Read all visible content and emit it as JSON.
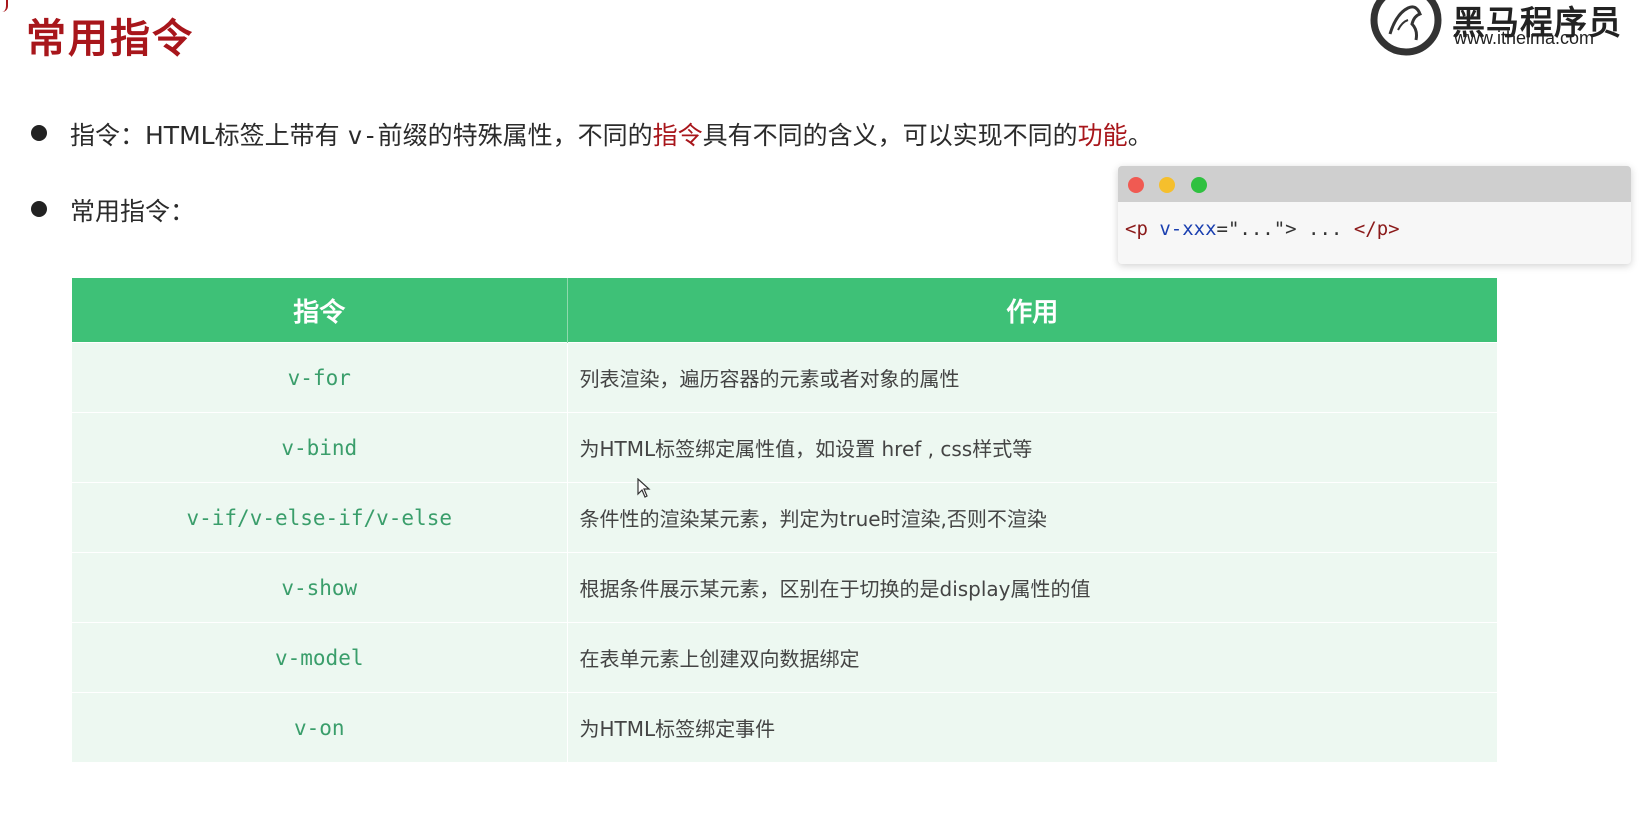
{
  "title": "常用指令",
  "logo": {
    "name": "黑马程序员",
    "url": "www.itheima.com"
  },
  "bullets": {
    "b1": {
      "prefix": "指令：HTML标签上带有 ",
      "code": "v-",
      "middle": "前缀的特殊属性，不同的",
      "hl1": "指令",
      "middle2": "具有不同的含义，可以实现不同的",
      "hl2": "功能",
      "suffix": "。"
    },
    "b2": "常用指令："
  },
  "code_snippet": {
    "open_tag": "<p ",
    "attr": "v-xxx",
    "rest": "=\"...\">",
    "content": " ... ",
    "close_tag": "</p>"
  },
  "table": {
    "headers": [
      "指令",
      "作用"
    ],
    "rows": [
      {
        "directive": "v-for",
        "desc": "列表渲染，遍历容器的元素或者对象的属性"
      },
      {
        "directive": "v-bind",
        "desc": "为HTML标签绑定属性值，如设置 href , css样式等"
      },
      {
        "directive": "v-if/v-else-if/v-else",
        "desc": "条件性的渲染某元素，判定为true时渲染,否则不渲染"
      },
      {
        "directive": "v-show",
        "desc": "根据条件展示某元素，区别在于切换的是display属性的值"
      },
      {
        "directive": "v-model",
        "desc": "在表单元素上创建双向数据绑定"
      },
      {
        "directive": "v-on",
        "desc": "为HTML标签绑定事件"
      }
    ]
  },
  "colors": {
    "title_red": "#a8161b",
    "table_header_green": "#3ec177",
    "row_bg": "#edf8f1",
    "directive_text": "#3a9e6b"
  }
}
